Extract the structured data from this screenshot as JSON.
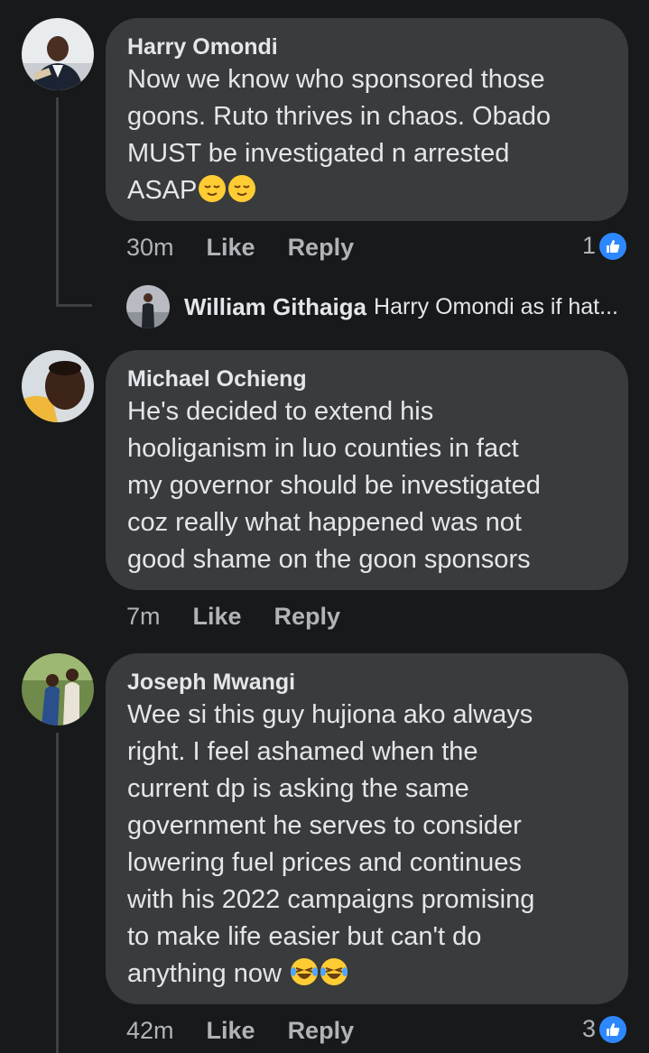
{
  "comments": [
    {
      "author": "Harry Omondi",
      "lines": [
        "Now we know who sponsored those",
        "goons. Ruto thrives in chaos. Obado",
        "MUST be investigated n arrested",
        "ASAP"
      ],
      "emoji": "relieved-face",
      "time": "30m",
      "like": "Like",
      "reply": "Reply",
      "reaction_count": "1",
      "reply_preview": {
        "author": "William Githaiga",
        "snippet": "Harry Omondi as if hat..."
      }
    },
    {
      "author": "Michael Ochieng",
      "lines": [
        "He's decided to extend his",
        "hooliganism in luo counties in fact",
        "my governor should be investigated",
        "coz really what happened was not",
        "good shame on the goon sponsors"
      ],
      "time": "7m",
      "like": "Like",
      "reply": "Reply"
    },
    {
      "author": "Joseph Mwangi",
      "lines": [
        "Wee si this guy hujiona ako always",
        "right. I feel ashamed when the",
        "current dp is asking the same",
        "government he serves to consider",
        "lowering fuel prices and continues",
        "with his 2022 campaigns promising",
        "to make life easier but can't do",
        "anything now"
      ],
      "emoji": "laughing-tears-face",
      "time": "42m",
      "like": "Like",
      "reply": "Reply",
      "reaction_count": "3"
    }
  ],
  "colors": {
    "background": "#18191a",
    "bubble": "#3a3b3c",
    "text": "#e4e6eb",
    "muted": "#b0b3b8",
    "like_blue": "#2d88ff"
  }
}
